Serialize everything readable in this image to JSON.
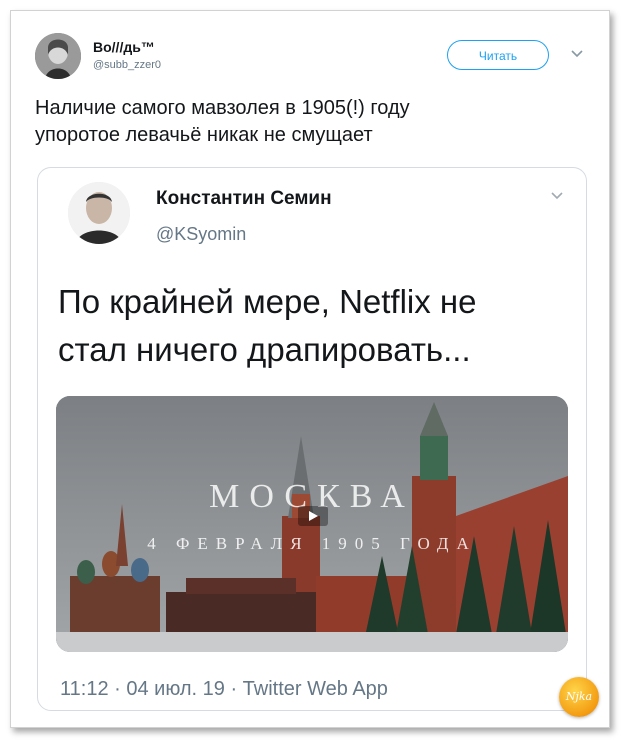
{
  "tweet": {
    "author": {
      "name": "Во///дь™",
      "handle": "@subb_zzer0",
      "avatar_icon": "portrait-avatar-icon"
    },
    "follow_label": "Читать",
    "menu_icon": "chevron-down-icon",
    "text_line1": "Наличие самого мавзолея в 1905(!) году",
    "text_line2": "упоротое левачьё никак не смущает"
  },
  "quoted": {
    "author": {
      "name": "Константин Семин",
      "handle": "@KSyomin"
    },
    "text_line1": "По крайней мере, Netflix не",
    "text_line2": "стал ничего драпировать...",
    "media": {
      "title": "МОСКВА",
      "subtitle": "4 ФЕВРАЛЯ 1905 ГОДА",
      "play_icon": "play-icon"
    },
    "meta": "11:12 · 04 июл. 19 · Twitter Web App"
  },
  "watermark": {
    "text": "Njka",
    "brand_color": "#f39c12"
  },
  "colors": {
    "accent": "#1da1f2",
    "text": "#14171a",
    "muted": "#657786"
  }
}
